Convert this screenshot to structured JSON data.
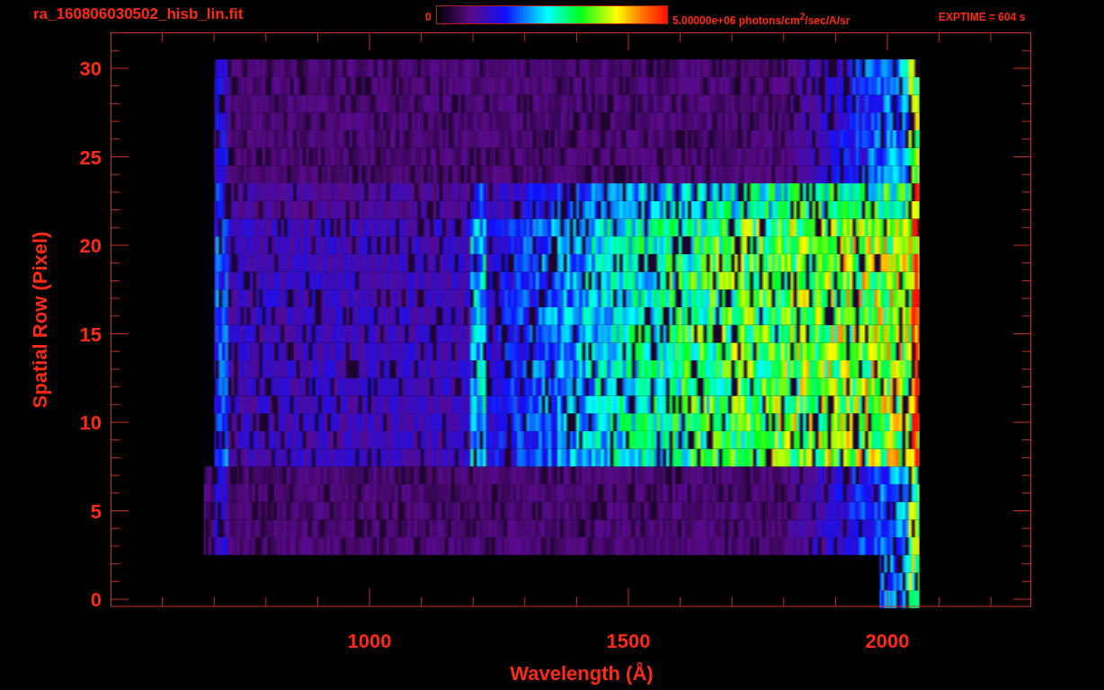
{
  "title": "ra_160806030502_hisb_lin.fit",
  "colorbar": {
    "min_label": "0",
    "max_label": "5.00000e+06 photons/cm$^{2}$/sec/A/sr"
  },
  "exptime": "EXPTIME = 604 s",
  "plot": {
    "xlabel": "Wavelength (Å)",
    "ylabel": "Spatial Row (Pixel)",
    "xticks": [
      "1000",
      "1500",
      "2000"
    ],
    "yticks": [
      "30",
      "25",
      "20",
      "15",
      "10",
      "5",
      "0"
    ]
  }
}
